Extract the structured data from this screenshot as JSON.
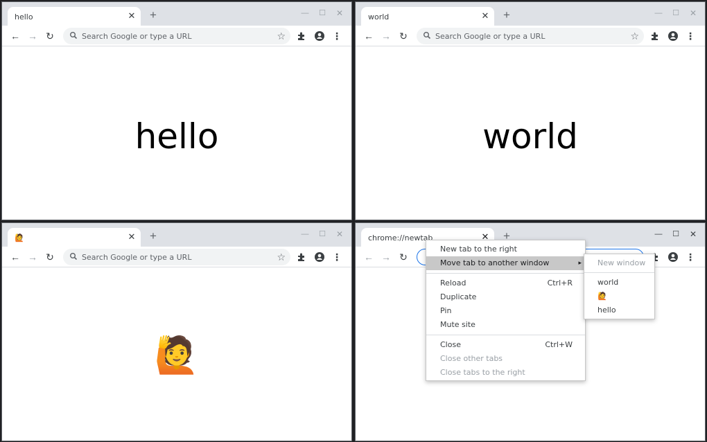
{
  "windows": {
    "top_left": {
      "tab_title": "hello",
      "omnibox_placeholder": "Search Google or type a URL",
      "page_text": "hello"
    },
    "top_right": {
      "tab_title": "world",
      "omnibox_placeholder": "Search Google or type a URL",
      "page_text": "world"
    },
    "bottom_left": {
      "tab_title": "🙋",
      "omnibox_placeholder": "Search Google or type a URL",
      "page_text": "🙋"
    },
    "bottom_right": {
      "tab_title": "chrome://newtab",
      "omnibox_placeholder": ""
    }
  },
  "glyphs": {
    "close": "✕",
    "new_tab": "+",
    "minimize": "—",
    "maximize": "☐",
    "window_close": "✕",
    "back": "←",
    "forward": "→",
    "reload": "↻",
    "star": "☆",
    "menu": "⋮",
    "submenu_arrow": "▸"
  },
  "context_menu": {
    "new_tab_right": "New tab to the right",
    "move_tab": "Move tab to another window",
    "reload": "Reload",
    "reload_shortcut": "Ctrl+R",
    "duplicate": "Duplicate",
    "pin": "Pin",
    "mute_site": "Mute site",
    "close": "Close",
    "close_shortcut": "Ctrl+W",
    "close_other": "Close other tabs",
    "close_right": "Close tabs to the right"
  },
  "submenu": {
    "new_window": "New window",
    "items": [
      "world",
      "🙋",
      "hello"
    ]
  },
  "colors": {
    "tabstrip": "#dee1e6",
    "highlight": "#c8c8c8",
    "focus_ring": "#1a73e8",
    "disabled_text": "#9aa0a6"
  }
}
